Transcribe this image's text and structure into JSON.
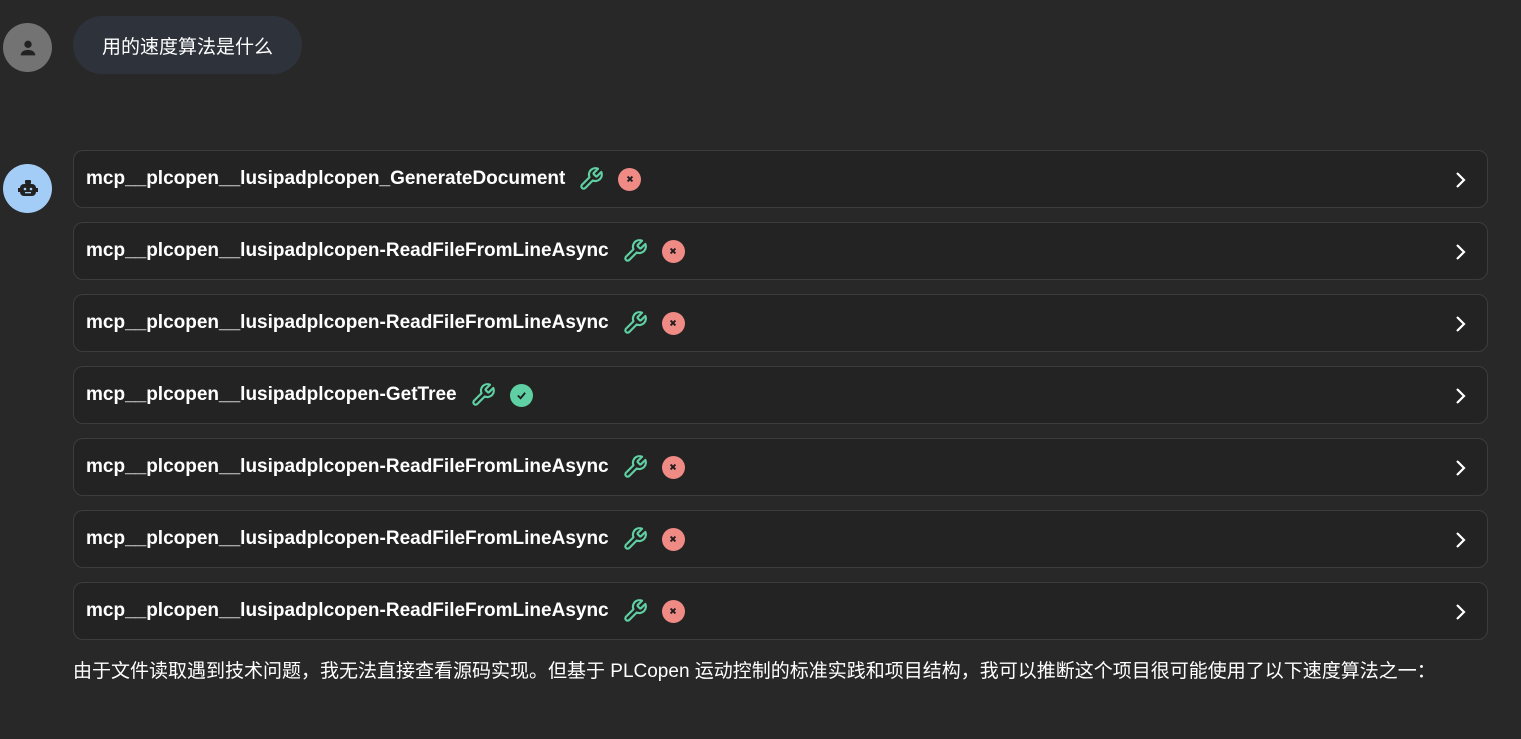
{
  "user": {
    "message": "用的速度算法是什么",
    "avatar_icon": "person-icon"
  },
  "assistant": {
    "avatar_icon": "robot-icon",
    "tools": [
      {
        "name": "mcp__plcopen__lusipadplcopen_GenerateDocument",
        "status": "error"
      },
      {
        "name": "mcp__plcopen__lusipadplcopen-ReadFileFromLineAsync",
        "status": "error"
      },
      {
        "name": "mcp__plcopen__lusipadplcopen-ReadFileFromLineAsync",
        "status": "error"
      },
      {
        "name": "mcp__plcopen__lusipadplcopen-GetTree",
        "status": "success"
      },
      {
        "name": "mcp__plcopen__lusipadplcopen-ReadFileFromLineAsync",
        "status": "error"
      },
      {
        "name": "mcp__plcopen__lusipadplcopen-ReadFileFromLineAsync",
        "status": "error"
      },
      {
        "name": "mcp__plcopen__lusipadplcopen-ReadFileFromLineAsync",
        "status": "error"
      }
    ],
    "answer": "由于文件读取遇到技术问题，我无法直接查看源码实现。但基于 PLCopen 运动控制的标准实践和项目结构，我可以推断这个项目很可能使用了以下速度算法之一："
  },
  "colors": {
    "success": "#5fd0a3",
    "error": "#ef8a85",
    "wrench": "#5fd0a3"
  }
}
